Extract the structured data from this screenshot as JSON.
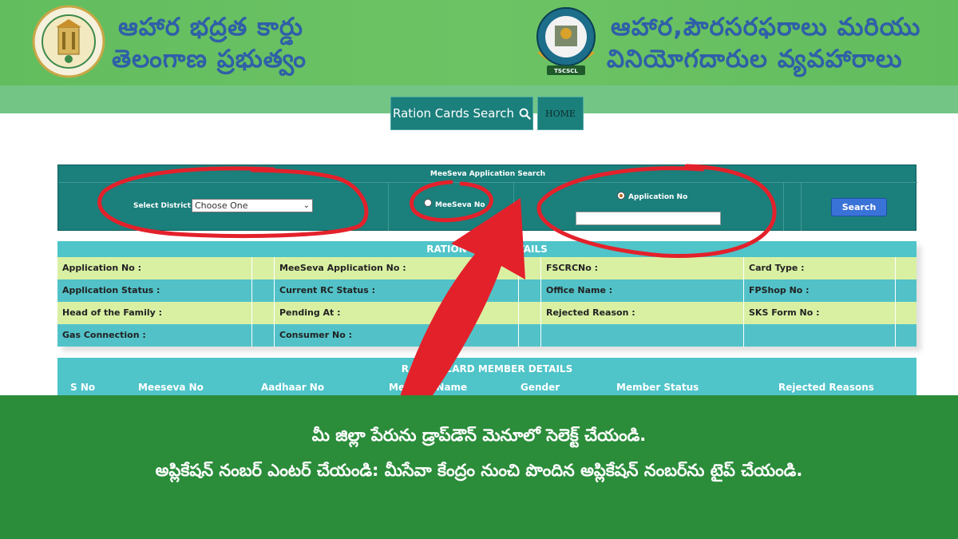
{
  "header": {
    "left_title_line1": "ఆహార భద్రత కార్డు",
    "left_title_line2": "తెలంగాణ ప్రభుత్వం",
    "right_title_line1": "ఆహార,పౌరసరఫరాలు మరియు",
    "right_title_line2": "వినియోగదారుల వ్యవహారాలు",
    "left_logo_icon": "telangana-emblem-icon",
    "right_logo_icon": "tscscl-logo-icon"
  },
  "nav": {
    "search_label": "Ration Cards Search",
    "search_icon": "search-icon",
    "home_label": "HOME"
  },
  "search_panel": {
    "title": "MeeSeva Application Search",
    "district_label": "Select District :",
    "district_value": "Choose One",
    "meeseva_radio_label": "MeeSeva No",
    "application_radio_label": "Application No",
    "application_input_value": "",
    "search_button": "Search"
  },
  "ration_details": {
    "title": "RATION CARD DETAILS",
    "rows": [
      [
        "Application No :",
        "MeeSeva Application No :",
        "FSCRCNo :",
        "Card Type :"
      ],
      [
        "Application Status :",
        "Current RC Status :",
        "Office Name :",
        "FPShop No :"
      ],
      [
        "Head of the Family :",
        "Pending At :",
        "Rejected Reason :",
        "SKS Form No :"
      ],
      [
        "Gas Connection :",
        "Consumer No :",
        "",
        ""
      ]
    ]
  },
  "member_details": {
    "title": "RATION CARD MEMBER DETAILS",
    "columns": [
      "S No",
      "Meeseva No",
      "Aadhaar No",
      "Member Name",
      "Gender",
      "Member Status",
      "Rejected Reasons"
    ]
  },
  "banner": {
    "line1": "మీ జిల్లా పేరును డ్రాప్‌డౌన్ మెనూలో సెలెక్ట్ చేయండి.",
    "line2": "అప్లికేషన్ నంబర్ ఎంటర్ చేయండి: మీసేవా కేంద్రం నుంచి పొందిన అప్లికేషన్ నంబర్‌ను టైప్ చేయండి."
  },
  "colors": {
    "header_green": "#62bd5e",
    "title_blue": "#2f5fa8",
    "panel_teal": "#1b7f7c",
    "row_light": "#d9f0a3",
    "row_teal": "#52c2c8",
    "annotation_red": "#e3212b",
    "banner_green": "#2b8c3a",
    "search_button_blue": "#3a73d8"
  }
}
